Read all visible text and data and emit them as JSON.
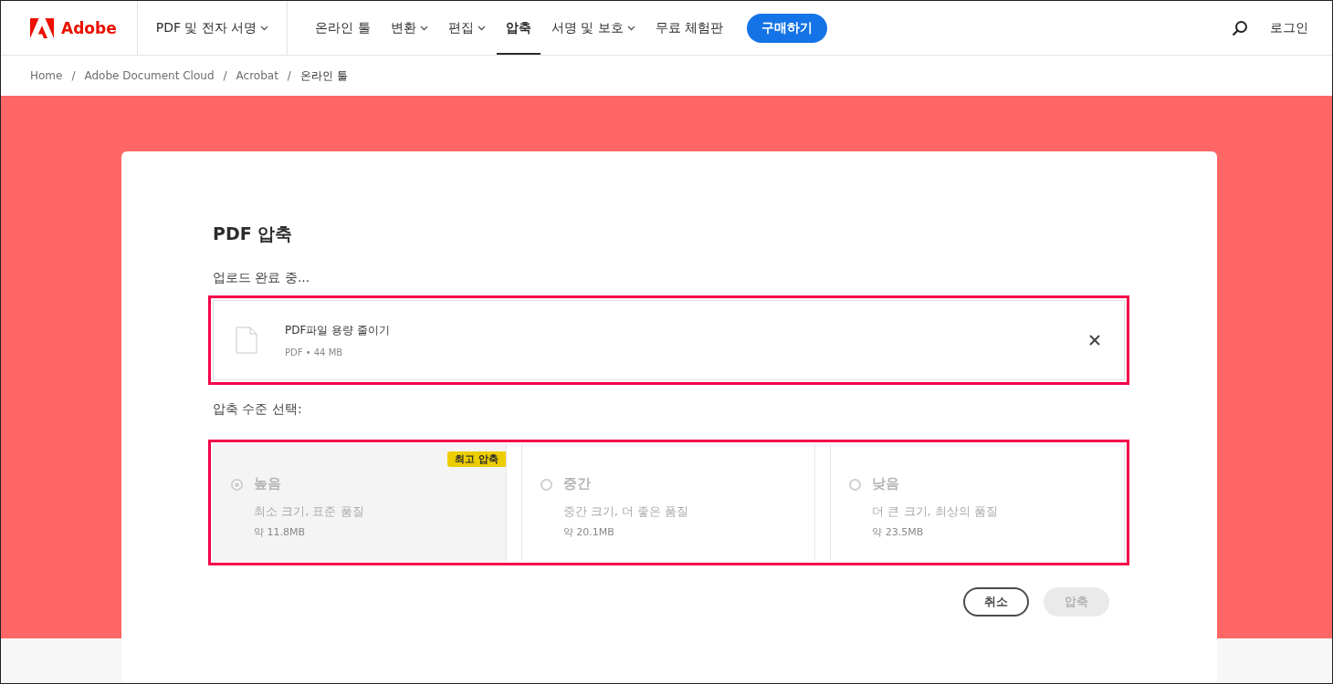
{
  "header": {
    "logo": "Adobe",
    "product_menu": {
      "label": "PDF 및 전자 서명",
      "has_caret": true
    },
    "nav": [
      {
        "label": "온라인 툴",
        "has_caret": false,
        "selected": false
      },
      {
        "label": "변환",
        "has_caret": true,
        "selected": false
      },
      {
        "label": "편집",
        "has_caret": true,
        "selected": false
      },
      {
        "label": "압축",
        "has_caret": false,
        "selected": true
      },
      {
        "label": "서명 및 보호",
        "has_caret": true,
        "selected": false
      },
      {
        "label": "무료 체험판",
        "has_caret": false,
        "selected": false
      }
    ],
    "buy_button": "구매하기",
    "login": "로그인"
  },
  "breadcrumb": [
    {
      "label": "Home"
    },
    {
      "separator": "/",
      "label": "Adobe Document Cloud"
    },
    {
      "separator": "/",
      "label": "Acrobat"
    },
    {
      "separator": "/",
      "label": "온라인 툴"
    }
  ],
  "card": {
    "title": "PDF 압축",
    "status": "업로드 완료 중...",
    "file": {
      "name": "PDF파일 용량 줄이기",
      "meta": "PDF • 44 MB",
      "highlighted": true
    },
    "level_prompt": "압축 수준 선택:",
    "options_highlighted": true,
    "options": [
      {
        "label": "높음",
        "description": "최소 크기, 표준 품질",
        "size": "약 11.8MB",
        "badge": "최고 압축",
        "selected": true
      },
      {
        "label": "중간",
        "description": "중간 크기, 더 좋은 품질",
        "size": "약 20.1MB",
        "selected": false
      },
      {
        "label": "낮음",
        "description": "더 큰 크기, 최상의 품질",
        "size": "약 23.5MB",
        "selected": false
      }
    ],
    "buttons": [
      {
        "label": "취소",
        "disabled": false
      },
      {
        "label": "압축",
        "disabled": true
      }
    ]
  }
}
